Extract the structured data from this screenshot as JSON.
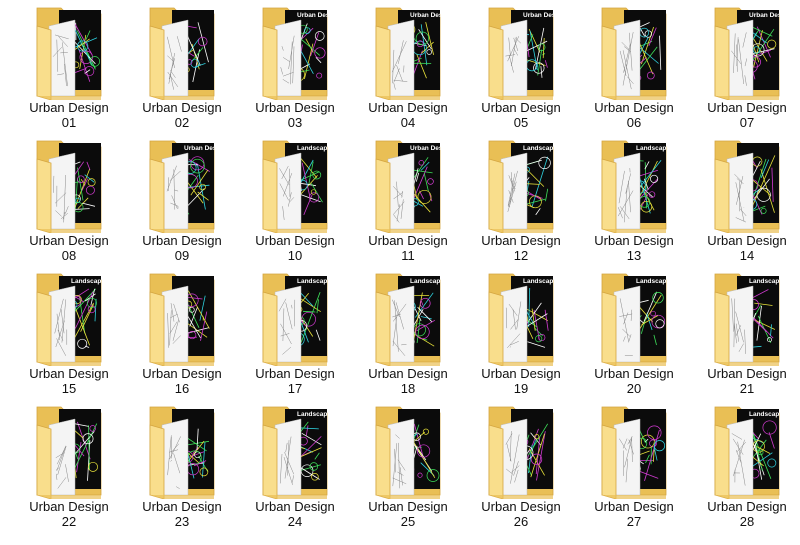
{
  "folder_icon": "folder-with-cad-thumbnails-icon",
  "colors": {
    "folder_back": "#e9bf55",
    "folder_front": "#f9de8c",
    "folder_edge": "#d4a540",
    "sheet_dark": "#0b0b0b",
    "sheet_light": "#f4f4f4",
    "cad_green": "#3ee05a",
    "cad_magenta": "#d23bd2",
    "cad_yellow": "#e8e23a"
  },
  "folders": [
    {
      "name": "Urban Design",
      "number": "01",
      "caption": ""
    },
    {
      "name": "Urban Design",
      "number": "02",
      "caption": ""
    },
    {
      "name": "Urban Design",
      "number": "03",
      "caption": "Urban Design Drawing"
    },
    {
      "name": "Urban Design",
      "number": "04",
      "caption": "Urban Design Drawing"
    },
    {
      "name": "Urban Design",
      "number": "05",
      "caption": "Urban Design Drawing"
    },
    {
      "name": "Urban Design",
      "number": "06",
      "caption": ""
    },
    {
      "name": "Urban Design",
      "number": "07",
      "caption": "Urban Design Drawing"
    },
    {
      "name": "Urban Design",
      "number": "08",
      "caption": ""
    },
    {
      "name": "Urban Design",
      "number": "09",
      "caption": "Urban Design Drawing"
    },
    {
      "name": "Urban Design",
      "number": "10",
      "caption": "Landscape Plan"
    },
    {
      "name": "Urban Design",
      "number": "11",
      "caption": "Urban Design Drawing"
    },
    {
      "name": "Urban Design",
      "number": "12",
      "caption": "Landscape Plan"
    },
    {
      "name": "Urban Design",
      "number": "13",
      "caption": "Landscape Plan"
    },
    {
      "name": "Urban Design",
      "number": "14",
      "caption": ""
    },
    {
      "name": "Urban Design",
      "number": "15",
      "caption": "Landscape Plan"
    },
    {
      "name": "Urban Design",
      "number": "16",
      "caption": ""
    },
    {
      "name": "Urban Design",
      "number": "17",
      "caption": "Landscape Plan"
    },
    {
      "name": "Urban Design",
      "number": "18",
      "caption": "Landscape Plan"
    },
    {
      "name": "Urban Design",
      "number": "19",
      "caption": "Landscape Plan"
    },
    {
      "name": "Urban Design",
      "number": "20",
      "caption": "Landscape Plan"
    },
    {
      "name": "Urban Design",
      "number": "21",
      "caption": "Landscape Plan"
    },
    {
      "name": "Urban Design",
      "number": "22",
      "caption": ""
    },
    {
      "name": "Urban Design",
      "number": "23",
      "caption": ""
    },
    {
      "name": "Urban Design",
      "number": "24",
      "caption": "Landscape Plan"
    },
    {
      "name": "Urban Design",
      "number": "25",
      "caption": ""
    },
    {
      "name": "Urban Design",
      "number": "26",
      "caption": ""
    },
    {
      "name": "Urban Design",
      "number": "27",
      "caption": ""
    },
    {
      "name": "Urban Design",
      "number": "28",
      "caption": "Landscape Plan"
    }
  ]
}
